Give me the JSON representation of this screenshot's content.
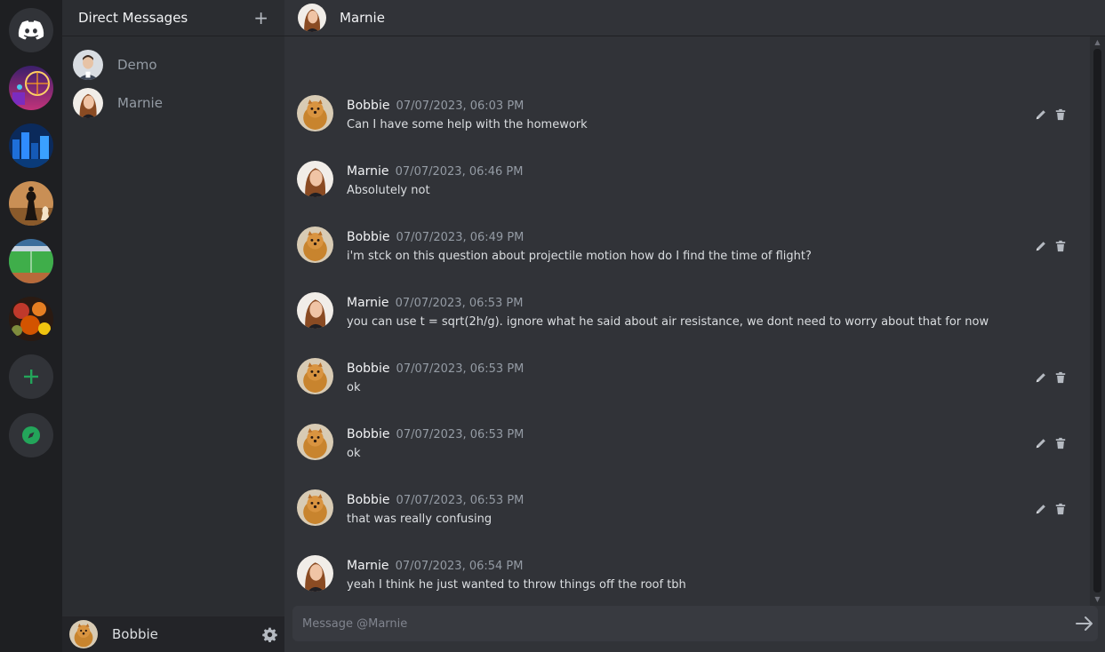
{
  "sidebar": {
    "title": "Direct Messages",
    "dms": [
      {
        "name": "Demo"
      },
      {
        "name": "Marnie"
      }
    ],
    "current_user": "Bobbie"
  },
  "header": {
    "title": "Marnie"
  },
  "composer": {
    "placeholder": "Message @Marnie"
  },
  "messages": [
    {
      "author": "Bobbie",
      "time": "07/07/2023, 06:03 PM",
      "text": "Can I have some help with the homework"
    },
    {
      "author": "Marnie",
      "time": "07/07/2023, 06:46 PM",
      "text": "Absolutely not"
    },
    {
      "author": "Bobbie",
      "time": "07/07/2023, 06:49 PM",
      "text": "i'm stck on this question about projectile motion how do I find the time of flight?"
    },
    {
      "author": "Marnie",
      "time": "07/07/2023, 06:53 PM",
      "text": "you can use t = sqrt(2h/g). ignore what he said about air resistance, we dont need to worry about that for now"
    },
    {
      "author": "Bobbie",
      "time": "07/07/2023, 06:53 PM",
      "text": "ok"
    },
    {
      "author": "Bobbie",
      "time": "07/07/2023, 06:53 PM",
      "text": "ok"
    },
    {
      "author": "Bobbie",
      "time": "07/07/2023, 06:53 PM",
      "text": "that was really confusing"
    },
    {
      "author": "Marnie",
      "time": "07/07/2023, 06:54 PM",
      "text": "yeah I think he just wanted to throw things off the roof tbh"
    }
  ],
  "colors": {
    "accent": "#23a55a",
    "background": "#313338",
    "sidebar": "#2b2d31",
    "rail": "#1e1f22"
  }
}
